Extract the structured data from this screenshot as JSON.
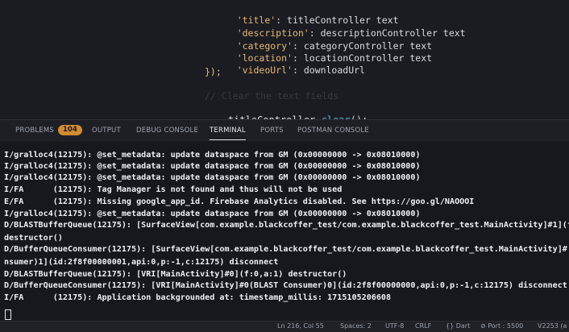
{
  "editor": {
    "lines": [
      {
        "key": "'title'",
        "colon": ": ",
        "val": "titleController text"
      },
      {
        "key": "'description'",
        "colon": ": ",
        "val": "descriptionController text"
      },
      {
        "key": "'category'",
        "colon": ": ",
        "val": "categoryController text"
      },
      {
        "key": "'location'",
        "colon": ": ",
        "val": "locationController text"
      },
      {
        "key": "'videoUrl'",
        "colon": ": ",
        "val": "downloadUrl"
      }
    ],
    "closing": "});",
    "comment": "// Clear the text fields",
    "call_obj": "titleController.",
    "call_fn": "clear",
    "call_end": "();"
  },
  "panel": {
    "tabs": [
      "PROBLEMS",
      "OUTPUT",
      "DEBUG CONSOLE",
      "TERMINAL",
      "PORTS",
      "POSTMAN CONSOLE"
    ],
    "problems_count": "104",
    "active_tab": "TERMINAL"
  },
  "terminal": {
    "lines": [
      "I/gralloc4(12175): @set_metadata: update dataspace from GM (0x00000000 -> 0x08010000)",
      "I/gralloc4(12175): @set_metadata: update dataspace from GM (0x00000000 -> 0x08010000)",
      "I/gralloc4(12175): @set_metadata: update dataspace from GM (0x00000000 -> 0x08010000)",
      "I/FA      (12175): Tag Manager is not found and thus will not be used",
      "E/FA      (12175): Missing google_app_id. Firebase Analytics disabled. See https://goo.gl/NAOOOI",
      "I/gralloc4(12175): @set_metadata: update dataspace from GM (0x00000000 -> 0x08010000)",
      "D/BLASTBufferQueue(12175): [SurfaceView[com.example.blackcoffer_test/com.example.blackcoffer_test.MainActivity]#1](f",
      "destructor()",
      "D/BufferQueueConsumer(12175): [SurfaceView[com.example.blackcoffer_test/com.example.blackcoffer_test.MainActivity]#",
      "nsumer)1](id:2f8f00000001,api:0,p:-1,c:12175) disconnect",
      "D/BLASTBufferQueue(12175): [VRI[MainActivity]#0](f:0,a:1) destructor()",
      "D/BufferQueueConsumer(12175): [VRI[MainActivity]#0(BLAST Consumer)0](id:2f8f00000000,api:0,p:-1,c:12175) disconnect",
      "I/FA      (12175): Application backgrounded at: timestamp_millis: 1715105206608"
    ]
  },
  "status": {
    "position": "Ln 216, Col 55",
    "spaces": "Spaces: 2",
    "encoding": "UTF-8",
    "eol": "CRLF",
    "language": "Dart",
    "port": "Port : 5500",
    "version": "V2253 (a"
  }
}
